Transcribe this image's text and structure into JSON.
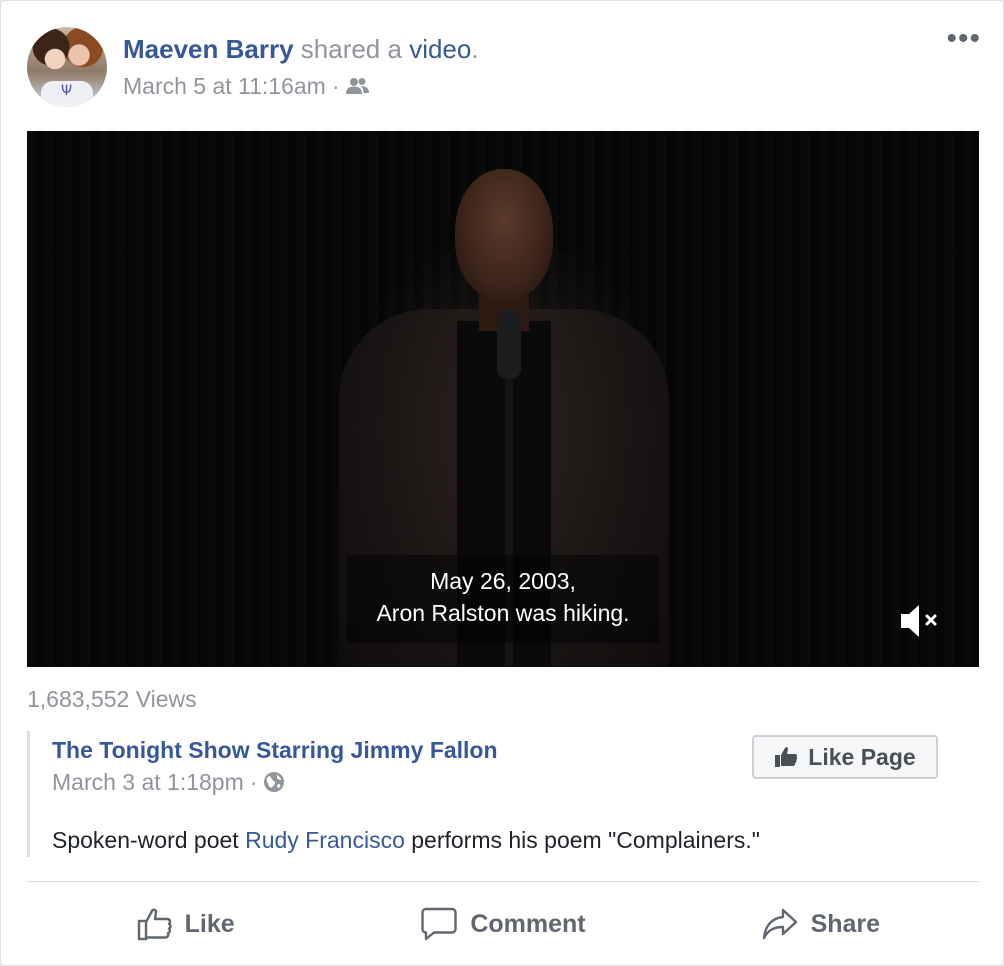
{
  "post": {
    "author": "Maeven Barry",
    "action_text": " shared a ",
    "object_link": "video",
    "object_suffix": ".",
    "timestamp": "March 5 at 11:16am",
    "separator": "·",
    "audience_icon": "friends-icon",
    "more_label": "•••"
  },
  "video": {
    "caption_line1": "May 26, 2003,",
    "caption_line2": "Aron Ralston was hiking.",
    "mute_icon": "speaker-muted-icon",
    "views": "1,683,552 Views"
  },
  "shared": {
    "page_name": "The Tonight Show Starring Jimmy Fallon",
    "timestamp": "March 3 at 1:18pm",
    "separator": "·",
    "audience_icon": "globe-icon",
    "like_page_label": "Like Page",
    "description_before": "Spoken-word poet ",
    "description_link": "Rudy Francisco",
    "description_after": " performs his poem \"Complainers.\""
  },
  "actions": {
    "like": "Like",
    "comment": "Comment",
    "share": "Share"
  },
  "colors": {
    "link": "#365899",
    "meta": "#90949c",
    "text": "#1d2129",
    "action": "#606770"
  }
}
